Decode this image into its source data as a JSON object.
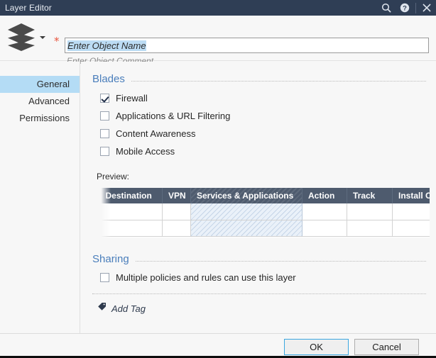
{
  "window": {
    "title": "Layer Editor",
    "actions": [
      {
        "name": "search-icon",
        "label": "Search"
      },
      {
        "name": "help-icon",
        "label": "Help"
      },
      {
        "name": "close-icon",
        "label": "Close"
      }
    ]
  },
  "object": {
    "icon": "layers-icon",
    "required_marker": "*",
    "name_value": "Enter Object Name",
    "name_placeholder": "Enter Object Name",
    "comment_placeholder": "Enter Object Comment"
  },
  "sidebar": {
    "items": [
      {
        "label": "General",
        "selected": true
      },
      {
        "label": "Advanced",
        "selected": false
      },
      {
        "label": "Permissions",
        "selected": false
      }
    ]
  },
  "blades": {
    "title": "Blades",
    "items": [
      {
        "label": "Firewall",
        "checked": true
      },
      {
        "label": "Applications & URL Filtering",
        "checked": false
      },
      {
        "label": "Content Awareness",
        "checked": false
      },
      {
        "label": "Mobile Access",
        "checked": false
      }
    ]
  },
  "preview": {
    "label": "Preview:",
    "columns": [
      {
        "label": "Destination",
        "highlighted": false
      },
      {
        "label": "VPN",
        "highlighted": false
      },
      {
        "label": "Services & Applications",
        "highlighted": true
      },
      {
        "label": "Action",
        "highlighted": false
      },
      {
        "label": "Track",
        "highlighted": false
      },
      {
        "label": "Install On",
        "highlighted": false
      }
    ],
    "rows": [
      [
        "",
        "",
        "",
        "",
        "",
        ""
      ],
      [
        "",
        "",
        "",
        "",
        "",
        ""
      ]
    ]
  },
  "sharing": {
    "title": "Sharing",
    "checkbox": {
      "label": "Multiple policies and rules can use this layer",
      "checked": false
    }
  },
  "tags": {
    "icon": "tag-icon",
    "label": "Add Tag"
  },
  "footer": {
    "ok_label": "OK",
    "cancel_label": "Cancel"
  },
  "colors": {
    "titlebar": "#2f3e55",
    "accent_blue": "#4a7ebb",
    "selection": "#b4dcf5",
    "table_header": "#4e5b6e",
    "focus_border": "#3ba7e0",
    "required": "#e8553d"
  }
}
